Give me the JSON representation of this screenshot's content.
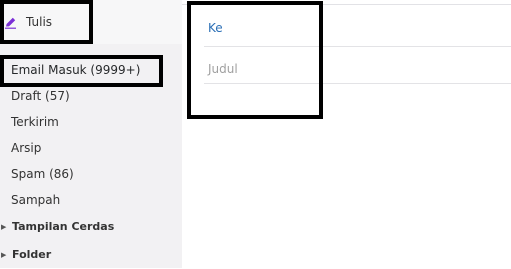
{
  "compose": {
    "label": "Tulis",
    "icon": "pencil-icon"
  },
  "folders": [
    {
      "label": "Email Masuk (9999+)"
    },
    {
      "label": "Draft (57)"
    },
    {
      "label": "Terkirim"
    },
    {
      "label": "Arsip"
    },
    {
      "label": "Spam (86)"
    },
    {
      "label": "Sampah"
    }
  ],
  "sections": [
    {
      "label": "Tampilan Cerdas"
    },
    {
      "label": "Folder"
    }
  ],
  "form": {
    "to_label": "Ke",
    "subject_label": "Judul"
  },
  "colors": {
    "accent": "#6001d2",
    "link": "#2b6fb6",
    "sidebar_bg": "#f2f1f3"
  }
}
